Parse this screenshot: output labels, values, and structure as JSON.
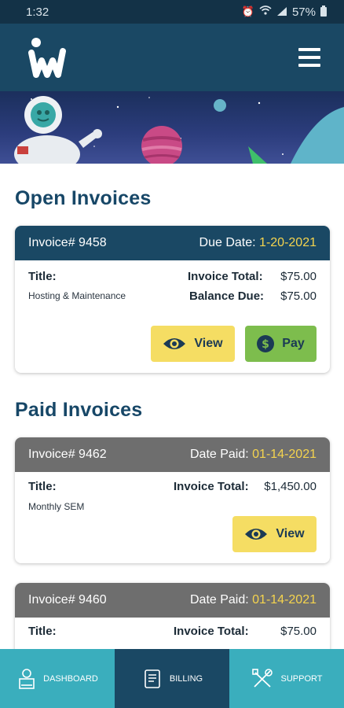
{
  "status_bar": {
    "time": "1:32",
    "battery": "57%"
  },
  "header": {
    "logo_icon": "iw-logo",
    "menu_icon": "hamburger-icon"
  },
  "banner": {
    "illustration": "astronaut-space-scene"
  },
  "open_section": {
    "title": "Open Invoices",
    "invoices": [
      {
        "number": "Invoice# 9458",
        "date_label": "Due Date:",
        "date": "1-20-2021",
        "title_label": "Title:",
        "title": "Hosting & Maintenance",
        "total_label": "Invoice Total:",
        "total": "$75.00",
        "balance_label": "Balance Due:",
        "balance": "$75.00",
        "view_label": "View",
        "pay_label": "Pay"
      }
    ]
  },
  "paid_section": {
    "title": "Paid Invoices",
    "invoices": [
      {
        "number": "Invoice# 9462",
        "date_label": "Date Paid:",
        "date": "01-14-2021",
        "title_label": "Title:",
        "title": "Monthly SEM",
        "total_label": "Invoice Total:",
        "total": "$1,450.00",
        "view_label": "View"
      },
      {
        "number": "Invoice# 9460",
        "date_label": "Date Paid:",
        "date": "01-14-2021",
        "title_label": "Title:",
        "total_label": "Invoice Total:",
        "total": "$75.00"
      }
    ]
  },
  "bottom_nav": [
    {
      "label": "DASHBOARD",
      "icon": "dashboard-icon"
    },
    {
      "label": "BILLING",
      "icon": "billing-icon",
      "active": true
    },
    {
      "label": "SUPPORT",
      "icon": "support-icon"
    }
  ],
  "colors": {
    "header_bg": "#1a4864",
    "accent_yellow": "#f5d44e",
    "view_button": "#f5dd63",
    "pay_button": "#7dbd4d",
    "nav_bg": "#3aaebd",
    "paid_header": "#6e6e6e"
  }
}
